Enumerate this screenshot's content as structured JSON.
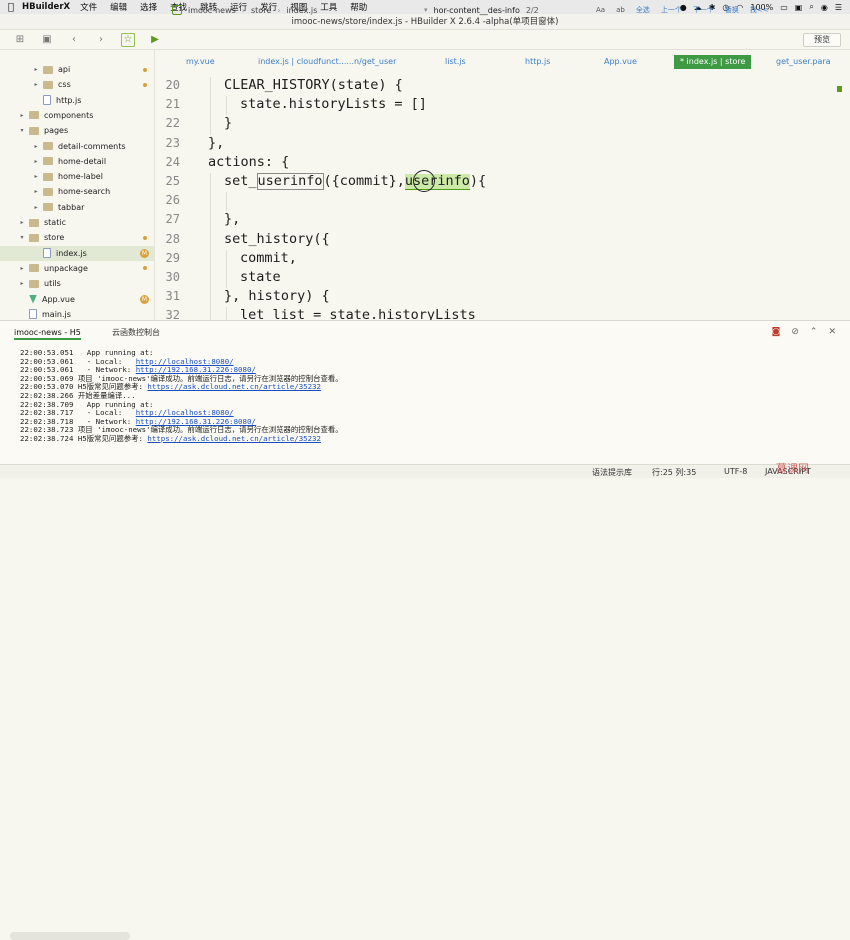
{
  "menubar": {
    "app_name": "HBuilderX",
    "items": [
      "文件",
      "编辑",
      "选择",
      "查找",
      "跳转",
      "运行",
      "发行",
      "视图",
      "工具",
      "帮助"
    ],
    "battery": "100%"
  },
  "window": {
    "title": "imooc-news/store/index.js - HBuilder X 2.6.4 -alpha(单项目窗体)"
  },
  "toolbar": {
    "breadcrumb": [
      "imooc-news",
      "store",
      "index.js"
    ],
    "search_value": "hor-content__des-info",
    "search_count": "2/2",
    "search_tools": [
      "Aa",
      "ab",
      "全选",
      "上一个",
      "下一个",
      "替换",
      "找<<"
    ],
    "preview_label": "预览"
  },
  "sidebar": {
    "items": [
      {
        "label": "api",
        "indent": 2,
        "type": "folder",
        "marker": "dot"
      },
      {
        "label": "css",
        "indent": 2,
        "type": "folder",
        "marker": "dot"
      },
      {
        "label": "http.js",
        "indent": 2,
        "type": "js",
        "marker": ""
      },
      {
        "label": "components",
        "indent": 1,
        "type": "folder",
        "marker": ""
      },
      {
        "label": "pages",
        "indent": 1,
        "type": "folder",
        "marker": "",
        "open": true
      },
      {
        "label": "detail-comments",
        "indent": 2,
        "type": "folder",
        "marker": ""
      },
      {
        "label": "home-detail",
        "indent": 2,
        "type": "folder",
        "marker": ""
      },
      {
        "label": "home-label",
        "indent": 2,
        "type": "folder",
        "marker": ""
      },
      {
        "label": "home-search",
        "indent": 2,
        "type": "folder",
        "marker": ""
      },
      {
        "label": "tabbar",
        "indent": 2,
        "type": "folder",
        "marker": ""
      },
      {
        "label": "static",
        "indent": 1,
        "type": "folder",
        "marker": ""
      },
      {
        "label": "store",
        "indent": 1,
        "type": "folder",
        "marker": "dot",
        "open": true
      },
      {
        "label": "index.js",
        "indent": 2,
        "type": "js",
        "marker": "M",
        "selected": true
      },
      {
        "label": "unpackage",
        "indent": 1,
        "type": "folder",
        "marker": "dot"
      },
      {
        "label": "utils",
        "indent": 1,
        "type": "folder",
        "marker": ""
      },
      {
        "label": "App.vue",
        "indent": 1,
        "type": "vue",
        "marker": "M"
      },
      {
        "label": "main.js",
        "indent": 1,
        "type": "js",
        "marker": ""
      }
    ]
  },
  "tabs": [
    {
      "label": "my.vue"
    },
    {
      "label": "index.js | cloudfunct......n/get_user"
    },
    {
      "label": "list.js"
    },
    {
      "label": "http.js"
    },
    {
      "label": "App.vue"
    },
    {
      "label": "* index.js | store",
      "active": true
    },
    {
      "label": "get_user.para"
    }
  ],
  "editor": {
    "lines": [
      {
        "n": "20",
        "indent": 1,
        "text": "CLEAR_HISTORY(state) {"
      },
      {
        "n": "21",
        "indent": 2,
        "text": "state.historyLists = []"
      },
      {
        "n": "22",
        "indent": 1,
        "text": "}"
      },
      {
        "n": "23",
        "indent": 0,
        "text": "},"
      },
      {
        "n": "24",
        "indent": 0,
        "text": "actions: {"
      },
      {
        "n": "25",
        "indent": 1,
        "text": ""
      },
      {
        "n": "26",
        "indent": 2,
        "text": ""
      },
      {
        "n": "27",
        "indent": 1,
        "text": "},"
      },
      {
        "n": "28",
        "indent": 1,
        "text": "set_history({"
      },
      {
        "n": "29",
        "indent": 2,
        "text": "commit,"
      },
      {
        "n": "30",
        "indent": 2,
        "text": "state"
      },
      {
        "n": "31",
        "indent": 1,
        "text": "}, history) {"
      },
      {
        "n": "32",
        "indent": 2,
        "text": "let list = state.historyLists"
      }
    ],
    "line25": {
      "pre": "set_",
      "word1": "userinfo",
      "mid": "({commit},",
      "word2": "userinfo",
      "post": "){"
    }
  },
  "panel": {
    "tabs": [
      "imooc-news - H5",
      "云函数控制台"
    ],
    "console": [
      {
        "t": "22:00:53.051",
        "msg": "  App running at:",
        "url": ""
      },
      {
        "t": "22:00:53.061",
        "msg": "  - Local:   ",
        "url": "http://localhost:8080/"
      },
      {
        "t": "22:00:53.061",
        "msg": "  - Network: ",
        "url": "http://192.168.31.226:8080/"
      },
      {
        "t": "22:00:53.069",
        "msg": "项目 'imooc-news'编译成功。前端运行日志，请另行在浏览器的控制台查看。",
        "url": ""
      },
      {
        "t": "22:00:53.070",
        "msg": "H5版常见问题参考: ",
        "url": "https://ask.dcloud.net.cn/article/35232"
      },
      {
        "t": "22:02:38.266",
        "msg": "开始差量编译...",
        "url": ""
      },
      {
        "t": "22:02:38.709",
        "msg": "  App running at:",
        "url": ""
      },
      {
        "t": "22:02:38.717",
        "msg": "  - Local:   ",
        "url": "http://localhost:8080/"
      },
      {
        "t": "22:02:38.718",
        "msg": "  - Network: ",
        "url": "http://192.168.31.226:8080/"
      },
      {
        "t": "22:02:38.723",
        "msg": "项目 'imooc-news'编译成功。前端运行日志，请另行在浏览器的控制台查看。",
        "url": ""
      },
      {
        "t": "22:02:38.724",
        "msg": "H5版常见问题参考: ",
        "url": "https://ask.dcloud.net.cn/article/35232"
      }
    ]
  },
  "statusbar": {
    "hint": "语法提示库",
    "position": "行:25  列:35",
    "encoding": "UTF-8",
    "language": "JAVASCRIPT"
  },
  "watermark": "慕课网"
}
